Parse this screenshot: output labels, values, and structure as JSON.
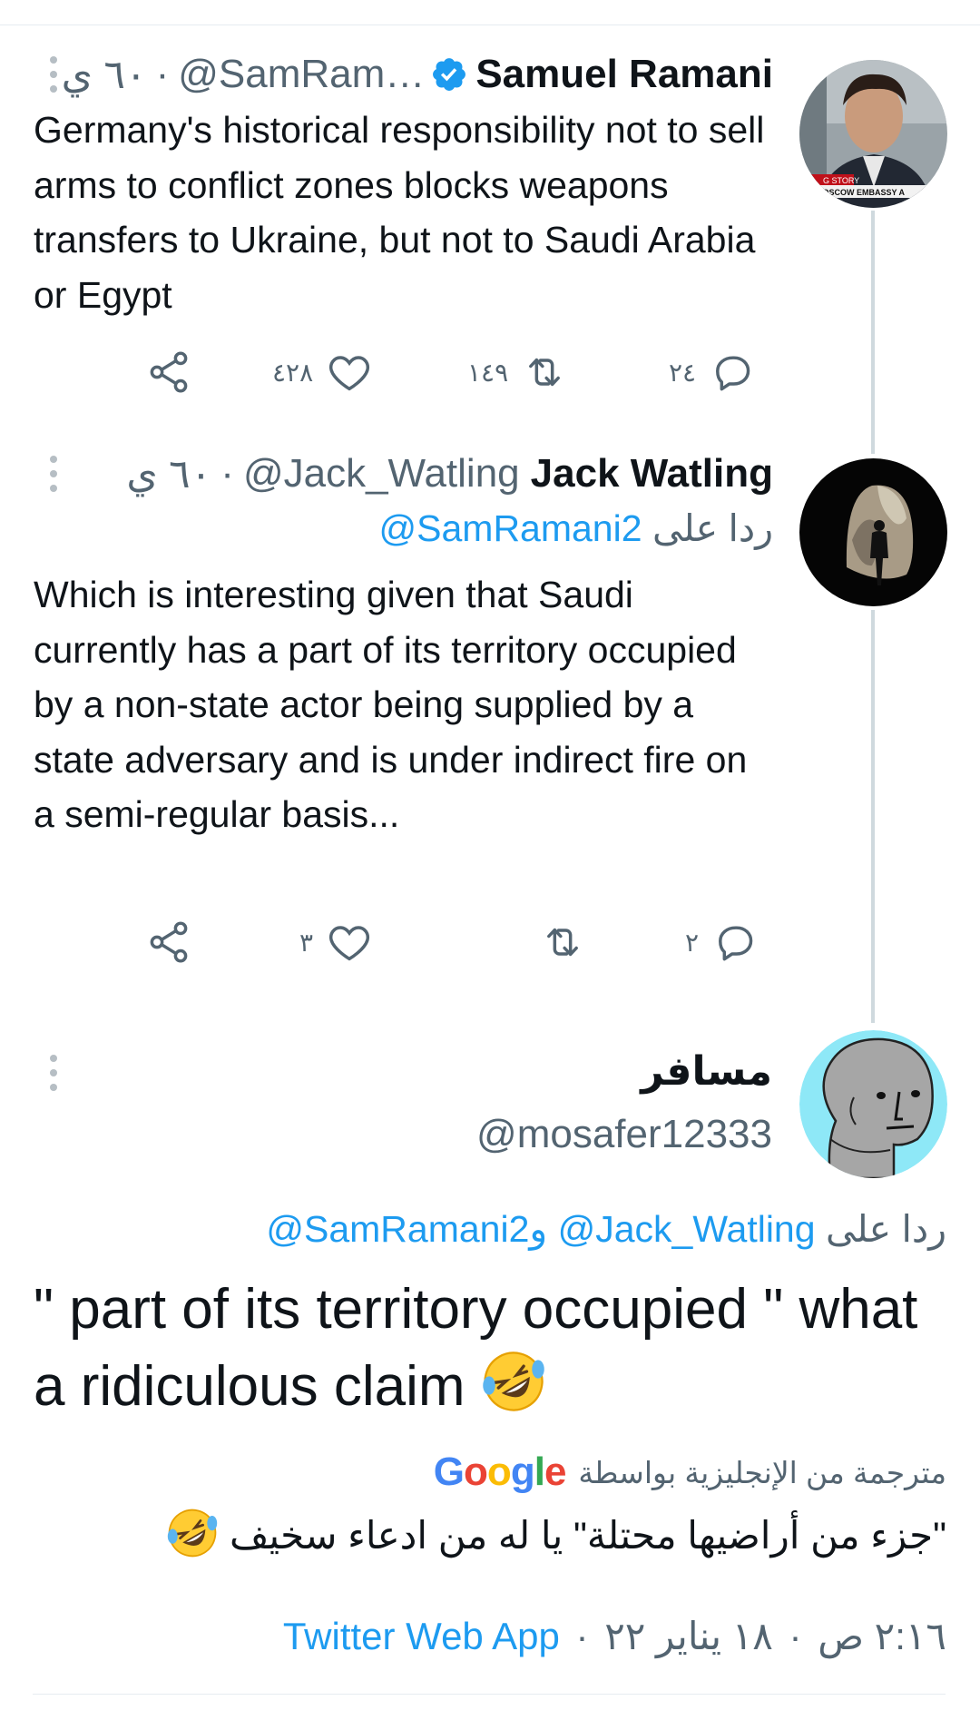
{
  "tweets": [
    {
      "name": "Samuel Ramani",
      "handle": "@SamRam…",
      "time": "٦٠ ي",
      "separator": "·",
      "text": "Germany's historical responsibility not to sell arms to conflict zones blocks weapons transfers to Ukraine, but not to Saudi Arabia or Egypt",
      "likes": "٤٢٨",
      "retweets": "١٤٩",
      "replies": "٢٤",
      "verified": true
    },
    {
      "name": "Jack Watling",
      "handle": "@Jack_Watling",
      "time": "٦٠ ي",
      "separator": "·",
      "replying_prefix": "ردا على",
      "replying_to": "@SamRamani2",
      "text": "Which is interesting given that Saudi currently has a part of its territory occupied by a non-state actor being supplied by a state adversary and is under indirect fire on a semi-regular basis...",
      "likes": "٣",
      "retweets": "",
      "replies": "٢"
    }
  ],
  "main_tweet": {
    "name": "مسافر",
    "handle": "@mosafer12333",
    "replying_prefix": "ردا على",
    "replying_to_1": "@Jack_Watling",
    "conjunction": "و",
    "replying_to_2": "@SamRamani2",
    "text": "\" part of its territory occupied \" what a ridiculous claim",
    "translated_label": "مترجمة من الإنجليزية بواسطة",
    "translator": "Google",
    "translation": "\"جزء من أراضيها محتلة\" يا له من ادعاء سخيف",
    "time": "٢:١٦ ص",
    "date": "١٨ يناير ٢٢",
    "separator": "·",
    "source": "Twitter Web App",
    "avatar_overlay_text": "G STORY / MOSCOW EMBASSY A"
  },
  "colors": {
    "link": "#1d9bf0",
    "secondary_text": "#536471",
    "primary_text": "#0f1419",
    "thread_line": "#cfd9de",
    "npc_background": "#8ee8f7"
  },
  "icons": [
    "share-icon",
    "heart-icon",
    "retweet-icon",
    "reply-icon",
    "more-icon",
    "verified-badge-icon",
    "rofl-emoji-icon"
  ]
}
